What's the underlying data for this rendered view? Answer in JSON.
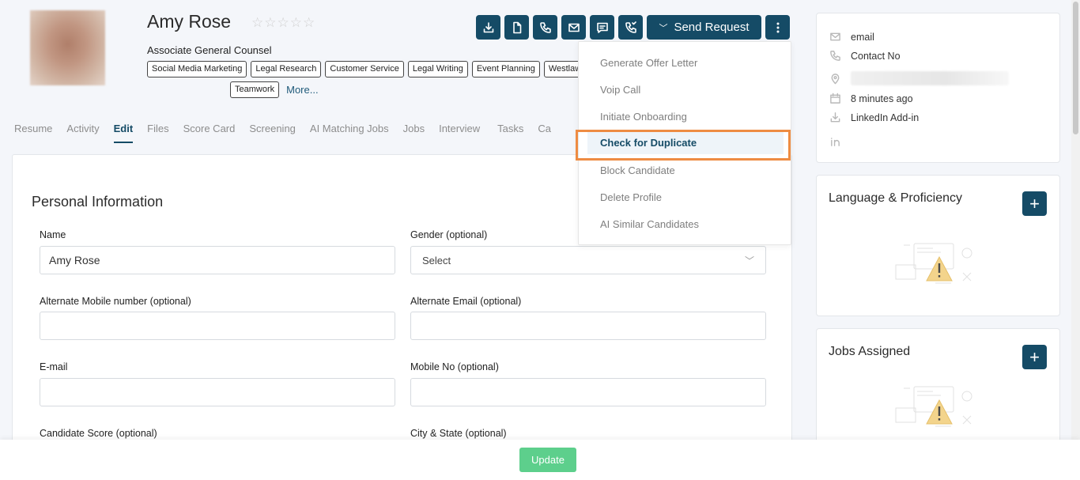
{
  "candidate": {
    "name": "Amy Rose",
    "title": "Associate General Counsel",
    "rating_stars": 5,
    "skills": [
      "Social Media Marketing",
      "Legal Research",
      "Customer Service",
      "Legal Writing",
      "Event Planning",
      "Westlaw",
      "Teamwork"
    ],
    "more_label": "More..."
  },
  "toolbar": {
    "send_request_label": "Send Request",
    "icons": [
      "download-icon",
      "file-icon",
      "phone-icon",
      "mail-icon",
      "message-icon",
      "voip-phone-icon",
      "chevron-down-icon",
      "kebab-menu-icon"
    ]
  },
  "tabs": [
    {
      "label": "Resume",
      "active": false
    },
    {
      "label": "Activity",
      "active": false
    },
    {
      "label": "Edit",
      "active": true
    },
    {
      "label": "Files",
      "active": false
    },
    {
      "label": "Score Card",
      "active": false
    },
    {
      "label": "Screening",
      "active": false
    },
    {
      "label": "AI Matching Jobs",
      "active": false
    },
    {
      "label": "Jobs",
      "active": false
    },
    {
      "label": "Interview",
      "active": false
    },
    {
      "label": "Tasks",
      "active": false
    },
    {
      "label": "Ca",
      "active": false
    }
  ],
  "menu": {
    "items": [
      {
        "label": "Generate Offer Letter"
      },
      {
        "label": "Voip Call"
      },
      {
        "label": "Initiate Onboarding"
      },
      {
        "label": "Check for Duplicate",
        "highlighted": true
      },
      {
        "label": "Block Candidate"
      },
      {
        "label": "Delete Profile"
      },
      {
        "label": "AI Similar Candidates"
      }
    ]
  },
  "form": {
    "section_title": "Personal Information",
    "name_label": "Name",
    "name_value": "Amy Rose",
    "gender_label": "Gender (optional)",
    "gender_value": "Select",
    "alt_mobile_label": "Alternate Mobile number (optional)",
    "alt_email_label": "Alternate Email (optional)",
    "email_label": "E-mail",
    "mobile_label": "Mobile No (optional)",
    "score_label": "Candidate Score (optional)",
    "city_label": "City & State (optional)"
  },
  "contact": {
    "email": "email",
    "phone": "Contact No",
    "updated": "8 minutes ago",
    "source": "LinkedIn Add-in"
  },
  "side": {
    "language_title": "Language & Proficiency",
    "jobs_title": "Jobs Assigned"
  },
  "footer": {
    "update_label": "Update"
  },
  "colors": {
    "primary": "#154b66",
    "highlight_border": "#ee8c43",
    "update_button": "#5dcf8c"
  }
}
